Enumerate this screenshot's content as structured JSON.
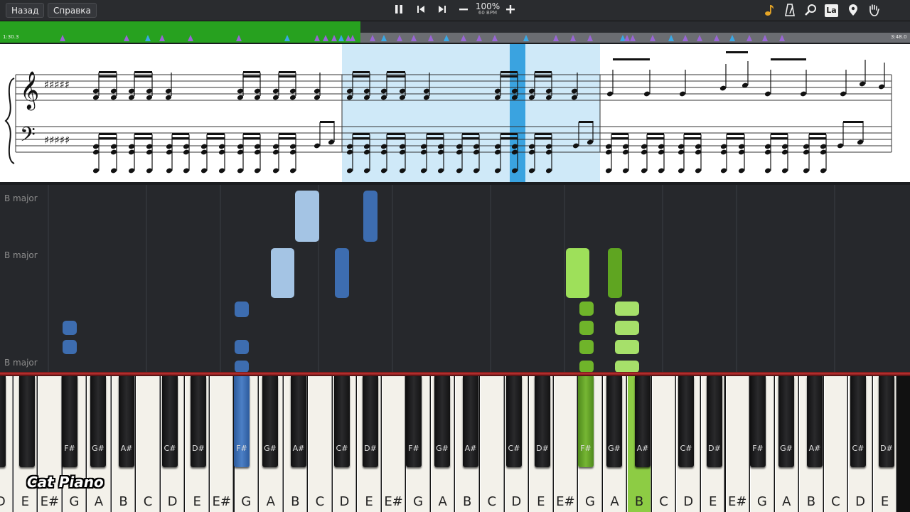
{
  "toolbar": {
    "back_label": "Назад",
    "help_label": "Справка",
    "pause_icon": "pause-icon",
    "prev_icon": "skip-back-icon",
    "next_icon": "skip-forward-icon",
    "zoom_percent": "100%",
    "bpm": "60 BPM",
    "right_icons": [
      "note-icon",
      "metronome-icon",
      "search-icon",
      "label-icon",
      "location-pin-icon",
      "hand-icon"
    ],
    "label_icon_text": "La"
  },
  "timeline": {
    "current_time": "1:30.3",
    "total_time": "3:48.0",
    "progress": 0.396
  },
  "roll": {
    "key_labels": [
      "B major",
      "B major",
      "B major"
    ]
  },
  "keyboard": {
    "white_keys": [
      "D",
      "E",
      "E#",
      "G",
      "A",
      "B",
      "C",
      "D",
      "E",
      "E#",
      "G",
      "A",
      "B",
      "C",
      "D",
      "E",
      "E#",
      "G",
      "A",
      "B",
      "C",
      "D",
      "E",
      "E#",
      "G",
      "A",
      "B",
      "C",
      "D",
      "E",
      "E#",
      "G",
      "A",
      "B",
      "C",
      "D",
      "E"
    ],
    "black_keys": [
      "F#",
      "G#",
      "A#",
      "C#",
      "D#",
      "F#",
      "G#",
      "A#",
      "C#",
      "D#",
      "F#",
      "G#",
      "A#",
      "C#",
      "D#",
      "F#",
      "G#",
      "A#",
      "C#",
      "D#",
      "F#",
      "G#",
      "A#",
      "C#",
      "D#"
    ]
  },
  "brand": "Cat Piano",
  "colors": {
    "left_hand": "#3d6db0",
    "right_hand": "#8dcc44",
    "progress": "#27a11f"
  }
}
